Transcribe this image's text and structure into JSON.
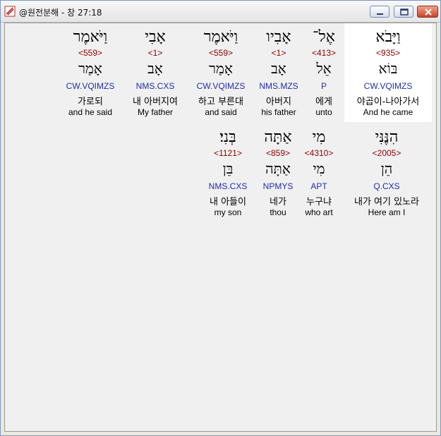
{
  "window": {
    "title": "@원전분해 - 창 27:18"
  },
  "rows": [
    [
      {
        "hebrew": "וַיָּבֹא",
        "strong": "<935>",
        "root": "בּוֹא",
        "parse": "CW.VQIMZS",
        "korean": "야곱이-나아가서",
        "english": "And he came",
        "highlight": true
      },
      {
        "hebrew": "אֶל־",
        "strong": "<413>",
        "root": "אֵל",
        "parse": "P",
        "korean": "에게",
        "english": "unto"
      },
      {
        "hebrew": "אָבִיו",
        "strong": "<1>",
        "root": "אָב",
        "parse": "NMS.MZS",
        "korean": "아버지",
        "english": "his father"
      },
      {
        "hebrew": "וַיֹּאמֶר",
        "strong": "<559>",
        "root": "אָמַר",
        "parse": "CW.VQIMZS",
        "korean": "하고 부른대",
        "english": "and said"
      },
      {
        "hebrew": "אָבִי",
        "strong": "<1>",
        "root": "אָב",
        "parse": "NMS.CXS",
        "korean": "내 아버지여",
        "english": "My father"
      },
      {
        "hebrew": "וַיֹּאמֶר",
        "strong": "<559>",
        "root": "אָמַר",
        "parse": "CW.VQIMZS",
        "korean": "가로되",
        "english": "and he said"
      }
    ],
    [
      {
        "hebrew": "הִנֶּנִּי",
        "strong": "<2005>",
        "root": "הֵן",
        "parse": "Q.CXS",
        "korean": "내가 여기 있노라",
        "english": "Here am I"
      },
      {
        "hebrew": "מִי",
        "strong": "<4310>",
        "root": "מִי",
        "parse": "APT",
        "korean": "누구냐",
        "english": "who art"
      },
      {
        "hebrew": "אַתָּה",
        "strong": "<859>",
        "root": "אַתָּה",
        "parse": "NPMYS",
        "korean": "네가",
        "english": "thou"
      },
      {
        "hebrew": "בְּנִי׃",
        "strong": "<1121>",
        "root": "בֵּן",
        "parse": "NMS.CXS",
        "korean": "내 아들이",
        "english": "my son"
      }
    ]
  ],
  "colors": {
    "strong": "#8b0000",
    "parse": "#1f2fa8",
    "highlight": "#ffffff"
  }
}
